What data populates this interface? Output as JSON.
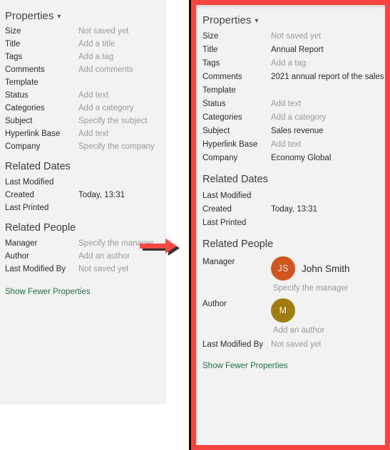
{
  "panels": {
    "before": {
      "header": {
        "title": "Properties",
        "chevron": "chevron-down-icon"
      },
      "properties": [
        {
          "label": "Size",
          "value": "Not saved yet",
          "filled": false
        },
        {
          "label": "Title",
          "value": "Add a title",
          "filled": false
        },
        {
          "label": "Tags",
          "value": "Add a tag",
          "filled": false
        },
        {
          "label": "Comments",
          "value": "Add comments",
          "filled": false
        },
        {
          "label": "Template",
          "value": "",
          "filled": false
        },
        {
          "label": "Status",
          "value": "Add text",
          "filled": false
        },
        {
          "label": "Categories",
          "value": "Add a category",
          "filled": false
        },
        {
          "label": "Subject",
          "value": "Specify the subject",
          "filled": false
        },
        {
          "label": "Hyperlink Base",
          "value": "Add text",
          "filled": false
        },
        {
          "label": "Company",
          "value": "Specify the company",
          "filled": false
        }
      ],
      "related_dates": {
        "title": "Related Dates",
        "rows": [
          {
            "label": "Last Modified",
            "value": ""
          },
          {
            "label": "Created",
            "value": "Today, 13:31"
          },
          {
            "label": "Last Printed",
            "value": ""
          }
        ]
      },
      "related_people": {
        "title": "Related People",
        "rows": [
          {
            "label": "Manager",
            "value": "Specify the manager"
          },
          {
            "label": "Author",
            "value": "Add an author"
          },
          {
            "label": "Last Modified By",
            "value": "Not saved yet"
          }
        ]
      },
      "show_fewer": "Show Fewer Properties"
    },
    "after": {
      "header": {
        "title": "Properties",
        "chevron": "chevron-down-icon"
      },
      "properties": [
        {
          "label": "Size",
          "value": "Not saved yet",
          "filled": false
        },
        {
          "label": "Title",
          "value": "Annual Report",
          "filled": true
        },
        {
          "label": "Tags",
          "value": "Add a tag",
          "filled": false
        },
        {
          "label": "Comments",
          "value": "2021 annual report of the sales",
          "filled": true
        },
        {
          "label": "Template",
          "value": "",
          "filled": false
        },
        {
          "label": "Status",
          "value": "Add text",
          "filled": false
        },
        {
          "label": "Categories",
          "value": "Add a category",
          "filled": false
        },
        {
          "label": "Subject",
          "value": "Sales revenue",
          "filled": true
        },
        {
          "label": "Hyperlink Base",
          "value": "Add text",
          "filled": false
        },
        {
          "label": "Company",
          "value": "Economy Global",
          "filled": true
        }
      ],
      "related_dates": {
        "title": "Related Dates",
        "rows": [
          {
            "label": "Last Modified",
            "value": ""
          },
          {
            "label": "Created",
            "value": "Today, 13:31"
          },
          {
            "label": "Last Printed",
            "value": ""
          }
        ]
      },
      "related_people": {
        "title": "Related People",
        "manager": {
          "label": "Manager",
          "avatar_initials": "JS",
          "avatar_color": "#D1551F",
          "name": "John Smith",
          "hint": "Specify the manager"
        },
        "author": {
          "label": "Author",
          "avatar_initials": "M",
          "avatar_color": "#A07D0E",
          "name": "",
          "hint": "Add an author"
        },
        "last_modified_by": {
          "label": "Last Modified By",
          "value": "Not saved yet"
        }
      },
      "show_fewer": "Show Fewer Properties"
    }
  },
  "annotation": {
    "arrow": "right-arrow-annotation",
    "arrow_color": "#FA4A43",
    "highlight_border_color": "#F9453F"
  },
  "theme": {
    "panel_background": "#f2f2f2",
    "label_color": "#2b2b2b",
    "placeholder_color": "#9a9a9a",
    "link_color": "#217346"
  }
}
